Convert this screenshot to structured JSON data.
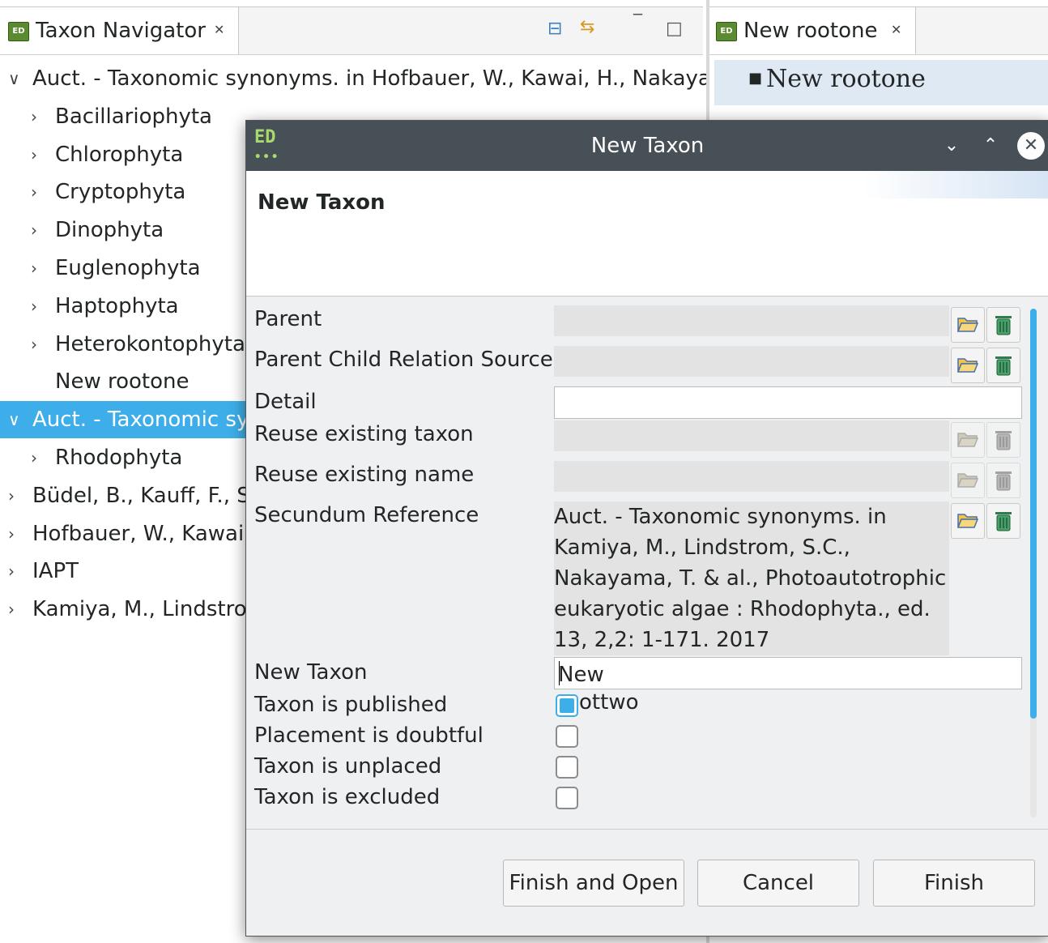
{
  "navigator": {
    "tab_title": "Taxon Navigator",
    "tab_close": "✕",
    "tree": [
      {
        "label": "Auct. - Taxonomic synonyms. in Hofbauer, W., Kawai, H., Nakayar",
        "chevron": "∨",
        "depth": 0,
        "selected": false
      },
      {
        "label": "Bacillariophyta",
        "chevron": "›",
        "depth": 1
      },
      {
        "label": "Chlorophyta",
        "chevron": "›",
        "depth": 1
      },
      {
        "label": "Cryptophyta",
        "chevron": "›",
        "depth": 1
      },
      {
        "label": "Dinophyta",
        "chevron": "›",
        "depth": 1
      },
      {
        "label": "Euglenophyta",
        "chevron": "›",
        "depth": 1
      },
      {
        "label": "Haptophyta",
        "chevron": "›",
        "depth": 1
      },
      {
        "label": "Heterokontophyta",
        "chevron": "›",
        "depth": 1
      },
      {
        "label": "New rootone",
        "chevron": "",
        "depth": 1
      },
      {
        "label": "Auct. - Taxonomic sy",
        "chevron": "∨",
        "depth": 0,
        "selected": true
      },
      {
        "label": "Rhodophyta",
        "chevron": "›",
        "depth": 1
      },
      {
        "label": "Büdel, B., Kauff, F., Sc",
        "chevron": "›",
        "depth": 0
      },
      {
        "label": "Hofbauer, W., Kawai,",
        "chevron": "›",
        "depth": 0
      },
      {
        "label": "IAPT",
        "chevron": "›",
        "depth": 0
      },
      {
        "label": "Kamiya, M., Lindstro",
        "chevron": "›",
        "depth": 0
      }
    ]
  },
  "editor": {
    "tab_title": "New rootone",
    "tab_close": "✕",
    "root_item": "New rootone",
    "bullet": "■"
  },
  "dialog": {
    "app_icon": "ED",
    "window_title": "New Taxon",
    "header_title": "New Taxon",
    "fields": {
      "parent": "Parent",
      "parent_child_relation_source": "Parent Child Relation Source",
      "detail": "Detail",
      "reuse_existing_taxon": "Reuse existing taxon",
      "reuse_existing_name": "Reuse existing name",
      "secundum_reference": "Secundum Reference",
      "new_taxon": "New Taxon",
      "taxon_is_published": "Taxon is published",
      "placement_is_doubtful": "Placement is doubtful",
      "taxon_is_unplaced": "Taxon is unplaced",
      "taxon_is_excluded": "Taxon is excluded"
    },
    "secundum_value": "Auct. - Taxonomic synonyms. in\nKamiya, M., Lindstrom, S.C.,\nNakayama, T. & al., Photoautotrophic\neukaryotic algae : Rhodophyta., ed.\n13, 2,2: 1-171. 2017",
    "new_taxon_value": "New roottwo",
    "detail_value": "",
    "checkboxes": {
      "taxon_is_published": true,
      "placement_is_doubtful": false,
      "taxon_is_unplaced": false,
      "taxon_is_excluded": false
    },
    "buttons": {
      "finish_and_open": "Finish and Open",
      "cancel": "Cancel",
      "finish": "Finish"
    },
    "icons": {
      "open": "folder-open-icon",
      "delete": "trash-icon"
    },
    "colors": {
      "accent": "#3daee9",
      "titlebar": "#475057"
    }
  }
}
